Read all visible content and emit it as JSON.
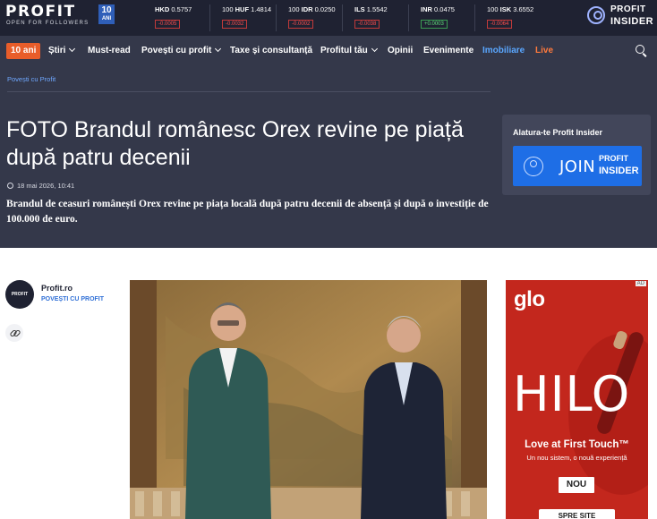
{
  "brand": {
    "logo_word": "PROFIT",
    "logo_tag": "OPEN FOR FOLLOWERS",
    "anniv_number": "10",
    "anniv_word": "ANI"
  },
  "tickers": [
    {
      "amount": "",
      "code": "HKD",
      "rate": "0.5757",
      "change": "-0.0005",
      "direction": "down"
    },
    {
      "amount": "100",
      "code": "HUF",
      "rate": "1.4814",
      "change": "-0.0032",
      "direction": "down"
    },
    {
      "amount": "100",
      "code": "IDR",
      "rate": "0.0250",
      "change": "-0.0002",
      "direction": "down"
    },
    {
      "amount": "",
      "code": "ILS",
      "rate": "1.5542",
      "change": "-0.0038",
      "direction": "down"
    },
    {
      "amount": "",
      "code": "INR",
      "rate": "0.0475",
      "change": "+0.0003",
      "direction": "up"
    },
    {
      "amount": "100",
      "code": "ISK",
      "rate": "3.6552",
      "change": "-0.0064",
      "direction": "down"
    }
  ],
  "insider": {
    "line1": "PROFIT",
    "line2": "INSIDER"
  },
  "nav": {
    "anniv_badge": "10 ani",
    "items": [
      {
        "label": "Știri"
      },
      {
        "label": "Must-read"
      },
      {
        "label": "Povești cu profit"
      },
      {
        "label": "Taxe și consultanță"
      },
      {
        "label": "Profitul tău"
      },
      {
        "label": "Opinii"
      },
      {
        "label": "Evenimente"
      },
      {
        "label": "Imobiliare"
      },
      {
        "label": "Live"
      }
    ]
  },
  "article": {
    "breadcrumb": "Povești cu Profit",
    "title": "FOTO Brandul românesc Orex revine pe piață după patru decenii",
    "date": "18 mai 2026, 10:41",
    "lead": "Brandul de ceasuri românești Orex revine pe piața locală după patru decenii de absență și după o investiție de 100.000 de euro.",
    "author_name": "Profit.ro",
    "author_section": "POVEȘTI CU PROFIT",
    "avatar_text": "PROFIT"
  },
  "join": {
    "title": "Alatura-te Profit Insider",
    "button_word": "JOIN",
    "button_brand1": "PROFIT",
    "button_brand2": "INSIDER"
  },
  "ad": {
    "tag": "AD",
    "brand": "glo",
    "product": "HILO",
    "headline": "Love at First Touch™",
    "subline": "Un nou sistem, o nouă experiență",
    "badge": "NOU",
    "cta": "SPRE SITE"
  }
}
